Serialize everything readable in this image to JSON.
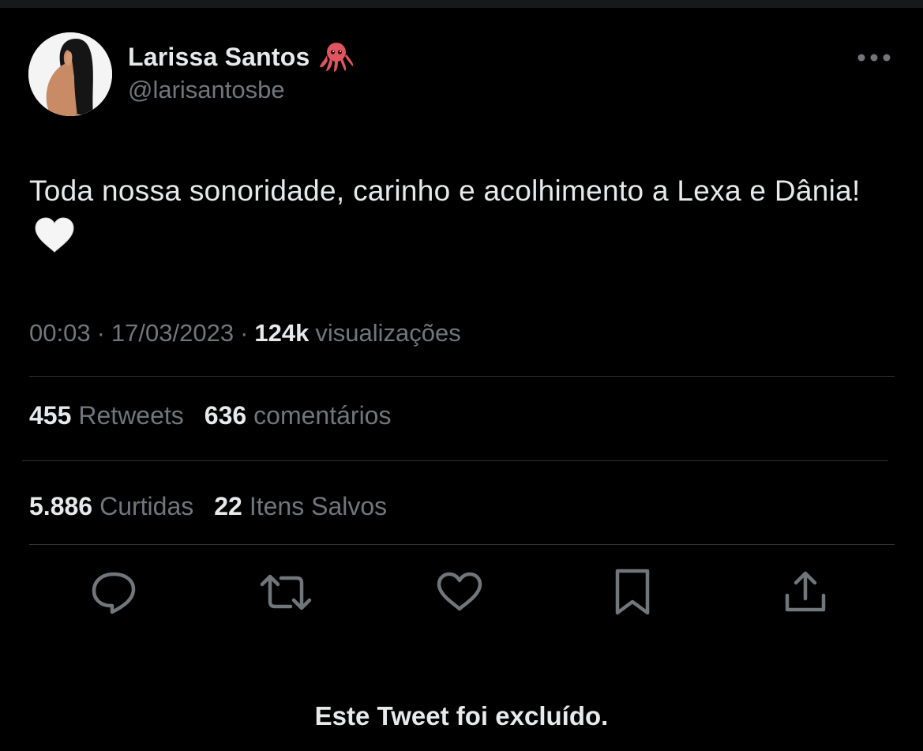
{
  "tweet": {
    "author": {
      "display_name": "Larissa Santos",
      "name_emoji": "octopus-emoji",
      "handle": "@larisantosbe"
    },
    "text": "Toda nossa sonoridade, carinho e acolhimento a Lexa e Dânia!",
    "text_emoji": "white-heart-emoji",
    "meta": {
      "time": "00:03",
      "separator": "·",
      "date": "17/03/2023",
      "views_count": "124k",
      "views_label": "visualizações"
    },
    "stats": {
      "retweets_count": "455",
      "retweets_label": "Retweets",
      "comments_count": "636",
      "comments_label": "comentários",
      "likes_count": "5.886",
      "likes_label": "Curtidas",
      "saves_count": "22",
      "saves_label": "Itens Salvos"
    },
    "actions": [
      "reply-icon",
      "retweet-icon",
      "like-icon",
      "bookmark-icon",
      "share-icon"
    ],
    "deleted_notice": "Este Tweet foi excluído."
  },
  "colors": {
    "background": "#000000",
    "primary_text": "#e7e9ea",
    "secondary_text": "#71767b",
    "divider": "#2f3336",
    "octopus": "#e0555f"
  }
}
